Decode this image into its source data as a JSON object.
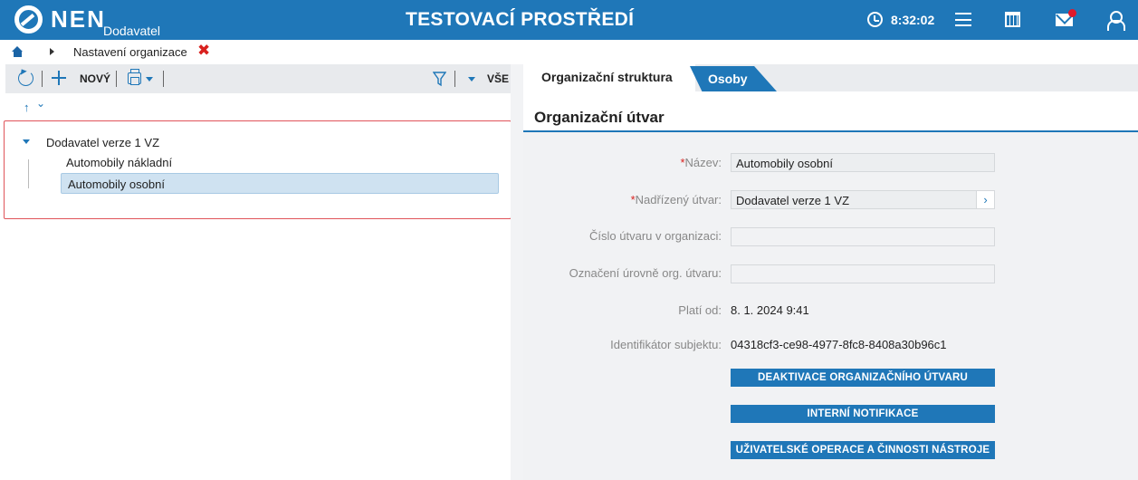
{
  "header": {
    "brand": "NEN",
    "brand_sub": "Dodavatel",
    "title": "TESTOVACÍ PROSTŘEDÍ",
    "time": "8:32:02",
    "accent_color": "#1f77b8",
    "icons": [
      "clock-icon",
      "menu-icon",
      "calendar-icon",
      "mail-icon",
      "user-icon"
    ]
  },
  "breadcrumb": {
    "item": "Nastavení organizace",
    "close_symbol": "✖"
  },
  "left_toolbar": {
    "new_label": "NOVÝ",
    "all_label": "VŠE"
  },
  "tree": {
    "root": "Dodavatel verze 1 VZ",
    "children": [
      "Automobily nákladní",
      "Automobily osobní"
    ],
    "selected": "Automobily osobní"
  },
  "tabs": {
    "active": "Organizační struktura",
    "second": "Osoby"
  },
  "form": {
    "section_title": "Organizační útvar",
    "fields": [
      {
        "label": "Název:",
        "required": true,
        "value": "Automobily osobní"
      },
      {
        "label": "Nadřízený útvar:",
        "required": true,
        "value": "Dodavatel verze 1 VZ"
      },
      {
        "label": "Číslo útvaru v organizaci:",
        "required": false,
        "value": ""
      },
      {
        "label": "Označení úrovně org. útvaru:",
        "required": false,
        "value": ""
      },
      {
        "label": "Platí od:",
        "required": false,
        "value": "8. 1. 2024 9:41"
      },
      {
        "label": "Identifikátor subjektu:",
        "required": false,
        "value": "04318cf3-ce98-4977-8fc8-8408a30b96c1"
      }
    ],
    "buttons": [
      "DEAKTIVACE ORGANIZAČNÍHO ÚTVARU",
      "INTERNÍ NOTIFIKACE",
      "UŽIVATELSKÉ OPERACE A ČINNOSTI NÁSTROJE"
    ]
  }
}
